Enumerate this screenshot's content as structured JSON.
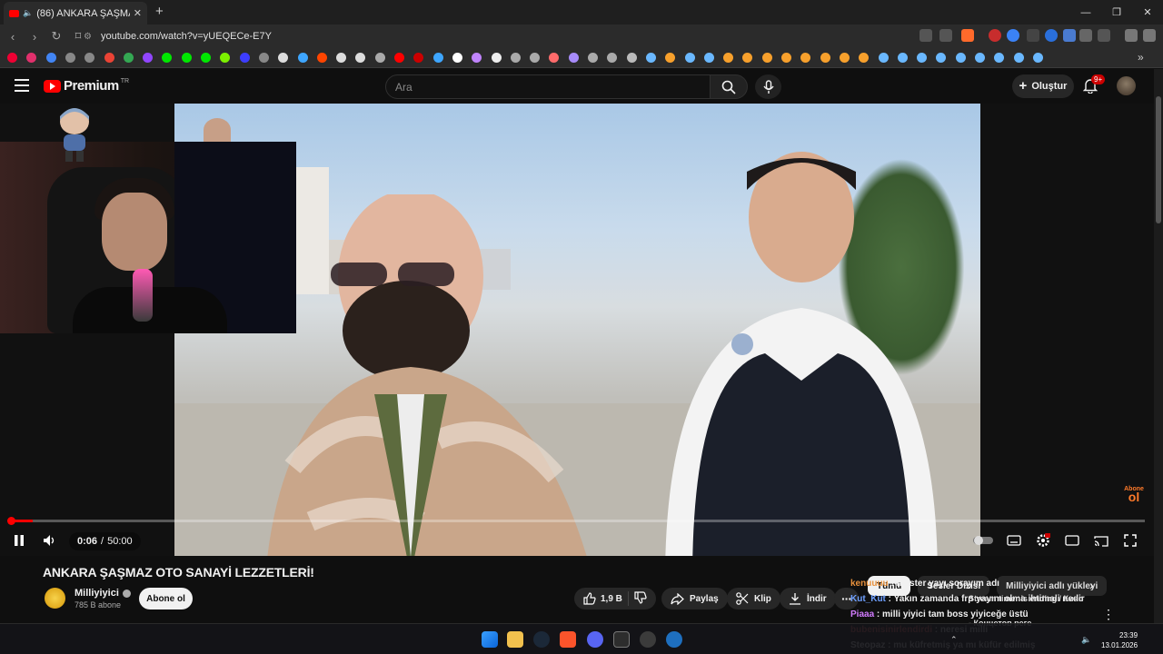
{
  "browser": {
    "tab_title": "(86) ANKARA ŞAŞMAZ OTO S",
    "url": "youtube.com/watch?v=yUEQECe-E7Y"
  },
  "youtube": {
    "logo_text": "Premium",
    "region": "TR",
    "search_placeholder": "Ara",
    "create_label": "Oluştur",
    "notif_count": "9+"
  },
  "player": {
    "time_current": "0:06",
    "time_separator": "/",
    "time_total": "50:00",
    "progress_fraction": 0.002,
    "overlay_abone_top": "Abone",
    "overlay_abone_main": "ol"
  },
  "video": {
    "title": "ANKARA ŞAŞMAZ OTO SANAYİ LEZZETLERİ!",
    "channel": "Milliyiyici",
    "subscribers": "785 B abone",
    "subscribe_label": "Abone ol",
    "likes": "1,9 B",
    "share_label": "Paylaş",
    "clip_label": "Klip",
    "download_label": "İndir"
  },
  "chips": [
    {
      "label": "Tümü",
      "active": true
    },
    {
      "label": "Sesler Dizisi",
      "active": false
    },
    {
      "label": "Milliyiyici adlı yükleyi",
      "active": false
    }
  ],
  "chat": [
    {
      "user": "kenuuuu",
      "msg": "master yayı sorayım adı",
      "color": "#e8913c"
    },
    {
      "user": "Kut_Kut",
      "msg": "Yakın zamanda frp yayını olma ihtimali nedir",
      "color": "#6fa0ff"
    },
    {
      "user": "Piaaa",
      "msg": "milli yiyici tam boss yiyiceğe üstü",
      "color": "#d27cff"
    },
    {
      "user": "bubenisinirlendirdi",
      "msg": "neresi milli",
      "color": "#ff6b6b"
    },
    {
      "user": "Steopaz",
      "msg": "mu küfretmiş ya mı küfür edilmiş",
      "color": "#ffffff"
    }
  ],
  "overlay_right": {
    "line1": "Stream timer is ending / Кино",
    "line2": "- Концетов реге"
  },
  "taskbar": {
    "time": "23:39",
    "date": "13.01.2026"
  }
}
